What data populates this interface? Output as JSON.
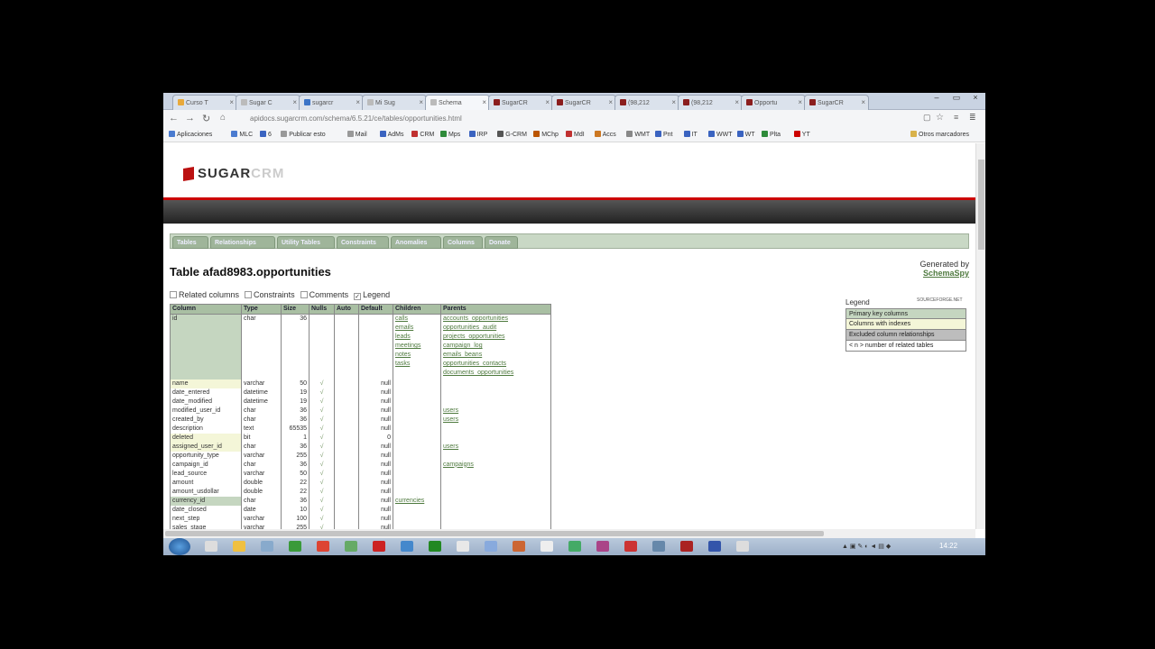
{
  "browser": {
    "tabs": [
      {
        "label": "Curso T",
        "color": "#e8a93b"
      },
      {
        "label": "Sugar C",
        "color": "#bbbbbb"
      },
      {
        "label": "sugarcr",
        "color": "#3b74c7"
      },
      {
        "label": "Mi Sug",
        "color": "#bbbbbb"
      },
      {
        "label": "Schema",
        "color": "#bbbbbb"
      },
      {
        "label": "SugarCR",
        "color": "#8b1e1e"
      },
      {
        "label": "SugarCR",
        "color": "#8b1e1e"
      },
      {
        "label": "(98,212",
        "color": "#8b1e1e"
      },
      {
        "label": "(98,212",
        "color": "#8b1e1e"
      },
      {
        "label": "Opportu",
        "color": "#8b1e1e"
      },
      {
        "label": "SugarCR",
        "color": "#8b1e1e"
      }
    ],
    "active_tab_index": 4,
    "url": "apidocs.sugarcrm.com/schema/6.5.21/ce/tables/opportunities.html",
    "bookmarks": [
      "Aplicaciones",
      "MLC",
      "6",
      "Publicar esto",
      "Mail",
      "AdMs",
      "CRM",
      "Mps",
      "IRP",
      "G-CRM",
      "MChp",
      "MdI",
      "Accs",
      "WMT",
      "Pnt",
      "IT",
      "WWT",
      "WT",
      "Plta",
      "YT",
      "Otros marcadores"
    ],
    "bookmark_colors": [
      "#4a7bd0",
      "#4a7bd0",
      "#3a63c0",
      "#999999",
      "#999999",
      "#3a63c0",
      "#c03030",
      "#2e8b3a",
      "#3a63c0",
      "#555555",
      "#bb5500",
      "#c03030",
      "#cc7722",
      "#888888",
      "#3a63c0",
      "#3a63c0",
      "#3a63c0",
      "#3a63c0",
      "#2e8b3a",
      "#cc0000",
      "#d9b24a"
    ]
  },
  "site": {
    "logo_text": "SUGAR",
    "logo_text_light": "CRM",
    "nav_tabs": [
      "Tables",
      "Relationships",
      "Utility Tables",
      "Constraints",
      "Anomalies",
      "Columns",
      "Donate"
    ]
  },
  "page": {
    "title": "Table afad8983.opportunities",
    "generated_by": "Generated by",
    "schemaspy": "SchemaSpy",
    "source_small": "SOURCEFORGE.NET",
    "options": [
      {
        "label": "Related columns",
        "checked": false
      },
      {
        "label": "Constraints",
        "checked": false
      },
      {
        "label": "Comments",
        "checked": false
      },
      {
        "label": "Legend",
        "checked": true
      }
    ],
    "legend": {
      "title": "Legend",
      "items": [
        {
          "label": "Primary key columns",
          "color": "#c5d6c0"
        },
        {
          "label": "Columns with indexes",
          "color": "#f4f6d8"
        },
        {
          "label": "Excluded column relationships",
          "color": "#bdbdbd"
        },
        {
          "label": "< n > number of related tables",
          "color": "#ffffff"
        }
      ]
    },
    "table": {
      "headers": [
        "Column",
        "Type",
        "Size",
        "Nulls",
        "Auto",
        "Default",
        "Children",
        "Parents"
      ],
      "id_row": {
        "column": "id",
        "type": "char",
        "size": "36",
        "children": [
          "calls",
          "emails",
          "leads",
          "meetings",
          "notes",
          "tasks"
        ],
        "parents": [
          "accounts_opportunities",
          "opportunities_audit",
          "projects_opportunities",
          "campaign_log",
          "emails_beans",
          "opportunities_contacts",
          "documents_opportunities"
        ]
      },
      "rows": [
        {
          "column": "name",
          "type": "varchar",
          "size": "50",
          "nulls": "√",
          "def": "null",
          "child": "",
          "parent": "",
          "cls": "idx"
        },
        {
          "column": "date_entered",
          "type": "datetime",
          "size": "19",
          "nulls": "√",
          "def": "null",
          "child": "",
          "parent": "",
          "cls": ""
        },
        {
          "column": "date_modified",
          "type": "datetime",
          "size": "19",
          "nulls": "√",
          "def": "null",
          "child": "",
          "parent": "",
          "cls": ""
        },
        {
          "column": "modified_user_id",
          "type": "char",
          "size": "36",
          "nulls": "√",
          "def": "null",
          "child": "",
          "parent": "users",
          "cls": ""
        },
        {
          "column": "created_by",
          "type": "char",
          "size": "36",
          "nulls": "√",
          "def": "null",
          "child": "",
          "parent": "users",
          "cls": ""
        },
        {
          "column": "description",
          "type": "text",
          "size": "65535",
          "nulls": "√",
          "def": "null",
          "child": "",
          "parent": "",
          "cls": ""
        },
        {
          "column": "deleted",
          "type": "bit",
          "size": "1",
          "nulls": "√",
          "def": "0",
          "child": "",
          "parent": "",
          "cls": "idx"
        },
        {
          "column": "assigned_user_id",
          "type": "char",
          "size": "36",
          "nulls": "√",
          "def": "null",
          "child": "",
          "parent": "users",
          "cls": "idx"
        },
        {
          "column": "opportunity_type",
          "type": "varchar",
          "size": "255",
          "nulls": "√",
          "def": "null",
          "child": "",
          "parent": "",
          "cls": ""
        },
        {
          "column": "campaign_id",
          "type": "char",
          "size": "36",
          "nulls": "√",
          "def": "null",
          "child": "",
          "parent": "campaigns",
          "cls": ""
        },
        {
          "column": "lead_source",
          "type": "varchar",
          "size": "50",
          "nulls": "√",
          "def": "null",
          "child": "",
          "parent": "",
          "cls": ""
        },
        {
          "column": "amount",
          "type": "double",
          "size": "22",
          "nulls": "√",
          "def": "null",
          "child": "",
          "parent": "",
          "cls": ""
        },
        {
          "column": "amount_usdollar",
          "type": "double",
          "size": "22",
          "nulls": "√",
          "def": "null",
          "child": "",
          "parent": "",
          "cls": ""
        },
        {
          "column": "currency_id",
          "type": "char",
          "size": "36",
          "nulls": "√",
          "def": "null",
          "child": "currencies",
          "parent": "",
          "cls": "pk"
        },
        {
          "column": "date_closed",
          "type": "date",
          "size": "10",
          "nulls": "√",
          "def": "null",
          "child": "",
          "parent": "",
          "cls": ""
        },
        {
          "column": "next_step",
          "type": "varchar",
          "size": "100",
          "nulls": "√",
          "def": "null",
          "child": "",
          "parent": "",
          "cls": ""
        },
        {
          "column": "sales_stage",
          "type": "varchar",
          "size": "255",
          "nulls": "√",
          "def": "null",
          "child": "",
          "parent": "",
          "cls": ""
        }
      ]
    }
  },
  "taskbar": {
    "clock": "14:22",
    "tray": "▲ ▣ ✎ ◐ ◄ ▤ ◆",
    "icon_colors": [
      "#dddddd",
      "#f0c040",
      "#88aacc",
      "#3a9a3a",
      "#dd4433",
      "#66aa66",
      "#cc2222",
      "#4488cc",
      "#228822",
      "#e8e8e8",
      "#88aadd",
      "#cc6633",
      "#eeeeee",
      "#44aa66",
      "#aa4488",
      "#cc3333",
      "#6688aa",
      "#aa2222",
      "#3355aa",
      "#dddddd"
    ]
  }
}
